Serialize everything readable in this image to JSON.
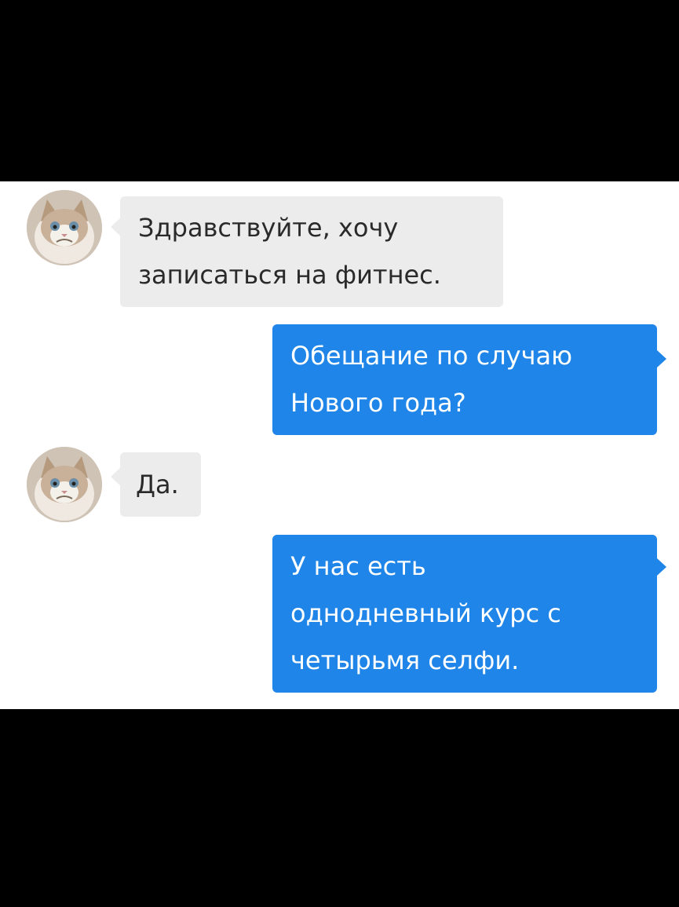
{
  "messages": [
    {
      "from": "contact",
      "avatar_icon": "grumpy-cat-avatar-icon",
      "lines": [
        "Здравствуйте, хочу",
        "записаться на фитнес."
      ]
    },
    {
      "from": "me",
      "lines": [
        "Обещание по случаю",
        "Нового года?"
      ]
    },
    {
      "from": "contact",
      "avatar_icon": "grumpy-cat-avatar-icon",
      "lines": [
        "Да."
      ]
    },
    {
      "from": "me",
      "lines": [
        "У нас есть",
        "однодневный курс с",
        "четырьмя селфи."
      ]
    }
  ],
  "colors": {
    "incoming_bubble": "#ececec",
    "outgoing_bubble": "#1f85e8",
    "incoming_text": "#2a2a2a",
    "outgoing_text": "#ffffff",
    "chat_background": "#ffffff",
    "frame": "#000000"
  }
}
